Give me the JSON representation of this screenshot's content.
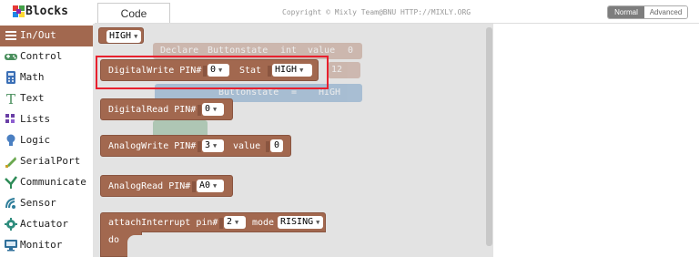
{
  "app": {
    "title": "Blocks",
    "logo_icon": "colorful-blocks-icon"
  },
  "sidebar": {
    "categories": [
      {
        "label": "In/Out",
        "icon": "in-out-icon",
        "active": true
      },
      {
        "label": "Control",
        "icon": "gamepad-icon"
      },
      {
        "label": "Math",
        "icon": "calculator-icon"
      },
      {
        "label": "Text",
        "icon": "text-t-icon"
      },
      {
        "label": "Lists",
        "icon": "lists-icon"
      },
      {
        "label": "Logic",
        "icon": "bulb-icon"
      },
      {
        "label": "SerialPort",
        "icon": "serial-port-icon"
      },
      {
        "label": "Communicate",
        "icon": "communicate-icon"
      },
      {
        "label": "Sensor",
        "icon": "sensor-icon"
      },
      {
        "label": "Actuator",
        "icon": "actuator-gear-icon"
      },
      {
        "label": "Monitor",
        "icon": "monitor-icon"
      }
    ],
    "active_color": "#a2684f"
  },
  "header": {
    "tab": "Code",
    "copyright": "Copyright © Mixly Team@BNU HTTP://MIXLY.ORG",
    "mode_normal": "Normal",
    "mode_advanced": "Advanced"
  },
  "ghost": {
    "declare": "Declare",
    "var_name": "Buttonstate",
    "type": "int",
    "value_label": "value",
    "value": "0",
    "pin": "12",
    "assign_var": "Buttonstate",
    "eq": "=",
    "assign_value": "HIGH"
  },
  "blocks": {
    "high": {
      "value": "HIGH"
    },
    "digital_write": {
      "label": "DigitalWrite PIN#",
      "pin": "0",
      "stat_label": "Stat",
      "stat": "HIGH"
    },
    "digital_read": {
      "label": "DigitalRead PIN#",
      "pin": "0"
    },
    "analog_write": {
      "label": "AnalogWrite PIN#",
      "pin": "3",
      "value_label": "value",
      "value": "0"
    },
    "analog_read": {
      "label": "AnalogRead PIN#",
      "pin": "A0"
    },
    "attach_interrupt": {
      "label": "attachInterrupt pin#",
      "pin": "2",
      "mode_label": "mode",
      "mode": "RISING",
      "do_label": "do"
    }
  },
  "colors": {
    "block": "#a2684f",
    "flyout": "#e3e3e3",
    "highlight": "#e8202e"
  }
}
